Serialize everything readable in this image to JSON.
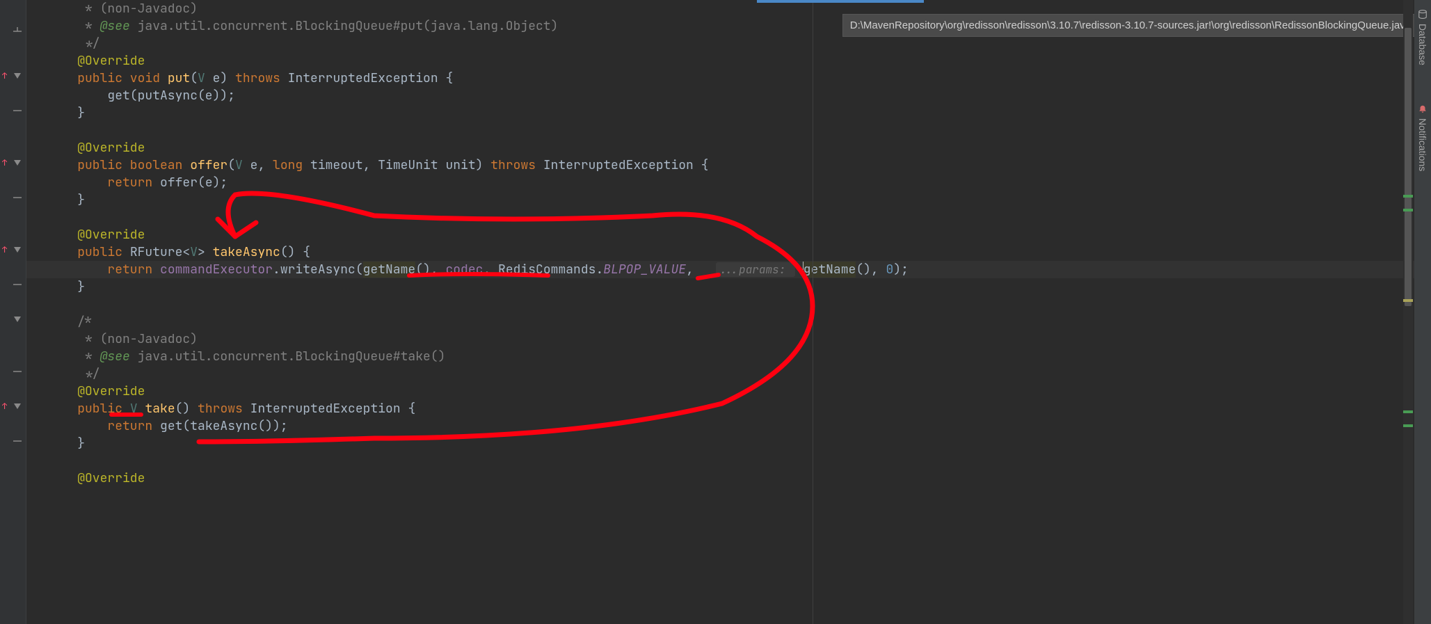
{
  "breadcrumb_path": "D:\\MavenRepository\\org\\redisson\\redisson\\3.10.7\\redisson-3.10.7-sources.jar!\\org\\redisson\\RedissonBlockingQueue.java",
  "side_tools": {
    "database": "Database",
    "notifications": "Notifications"
  },
  "code": {
    "l1": "     * (non-Javadoc)",
    "l2a": "     * ",
    "l2b": "@see",
    "l2c": " java.util.concurrent.BlockingQueue#put(java.lang.Object)",
    "l3": "     */",
    "l4": "    @Override",
    "l5a": "    ",
    "l5b": "public void ",
    "l5c": "put",
    "l5d": "(",
    "l5e": "V",
    "l5f": " e) ",
    "l5g": "throws ",
    "l5h": "InterruptedException {",
    "l6a": "        get(putAsync(e));",
    "l7": "    }",
    "l8": "",
    "l9": "    @Override",
    "l10a": "    ",
    "l10b": "public boolean ",
    "l10c": "offer",
    "l10d": "(",
    "l10e": "V",
    "l10f": " e, ",
    "l10g": "long ",
    "l10h": "timeout, ",
    "l10i": "TimeUnit ",
    "l10j": "unit) ",
    "l10k": "throws ",
    "l10l": "InterruptedException {",
    "l11a": "        ",
    "l11b": "return ",
    "l11c": "offer(e);",
    "l12": "    }",
    "l13": "",
    "l14": "    @Override",
    "l15a": "    ",
    "l15b": "public ",
    "l15c": "RFuture",
    "l15d": "<",
    "l15e": "V",
    "l15f": "> ",
    "l15g": "takeAsync",
    "l15h": "() {",
    "l16a": "        ",
    "l16b": "return ",
    "l16c": "commandExecutor",
    "l16d": ".writeAsync(",
    "l16e": "getName",
    "l16f": "(), ",
    "l16g": "codec",
    "l16h": ", ",
    "l16i": "RedisCommands",
    "l16j": ".",
    "l16k": "BLPOP_VALUE",
    "l16l": ", ",
    "l16m": "...params: ",
    "l16n": "getName",
    "l16o": "(), ",
    "l16p": "0",
    "l16q": ");",
    "l17": "    }",
    "l18": "",
    "l19": "    /*",
    "l20": "     * (non-Javadoc)",
    "l21a": "     * ",
    "l21b": "@see",
    "l21c": " java.util.concurrent.BlockingQueue#take()",
    "l22": "     */",
    "l23": "    @Override",
    "l24a": "    ",
    "l24b": "public ",
    "l24c": "V",
    "l24d": " ",
    "l24e": "take",
    "l24f": "() ",
    "l24g": "throws ",
    "l24h": "InterruptedException {",
    "l25a": "        ",
    "l25b": "return ",
    "l25c": "get(takeAsync());",
    "l26": "    }",
    "l27": "",
    "l28": "    @Override"
  }
}
